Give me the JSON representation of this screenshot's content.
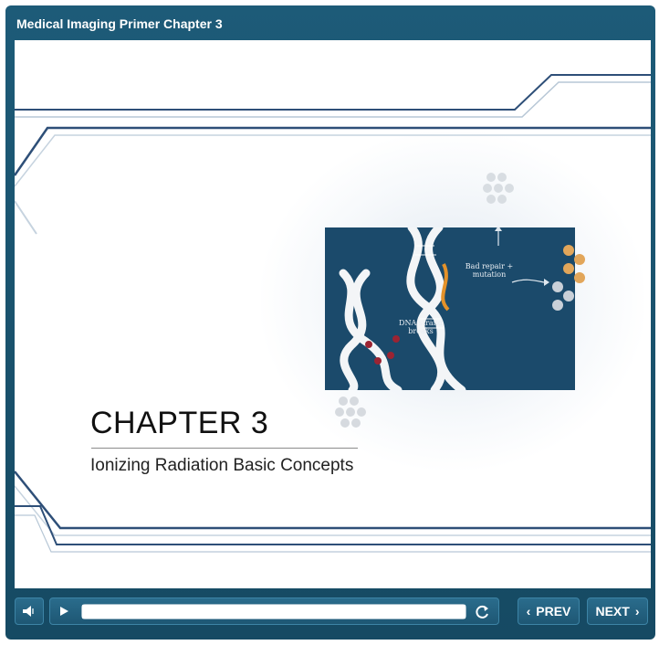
{
  "window": {
    "title": "Medical Imaging Primer Chapter 3"
  },
  "slide": {
    "heading": "CHAPTER 3",
    "subheading": "Ionizing Radiation Basic Concepts",
    "image": {
      "label_dna": "DNA strand breaks",
      "label_repair": "Bad repair + mutation"
    }
  },
  "controls": {
    "volume_icon": "speaker-icon",
    "play_icon": "play-icon",
    "replay_icon": "replay-icon",
    "progress_fraction": 1.0,
    "prev_label": "PREV",
    "next_label": "NEXT"
  },
  "colors": {
    "frame": "#1d5b78",
    "slide_bg": "#ffffff",
    "accent_line": "#2e4f78",
    "image_bg": "#1b4a6b"
  }
}
